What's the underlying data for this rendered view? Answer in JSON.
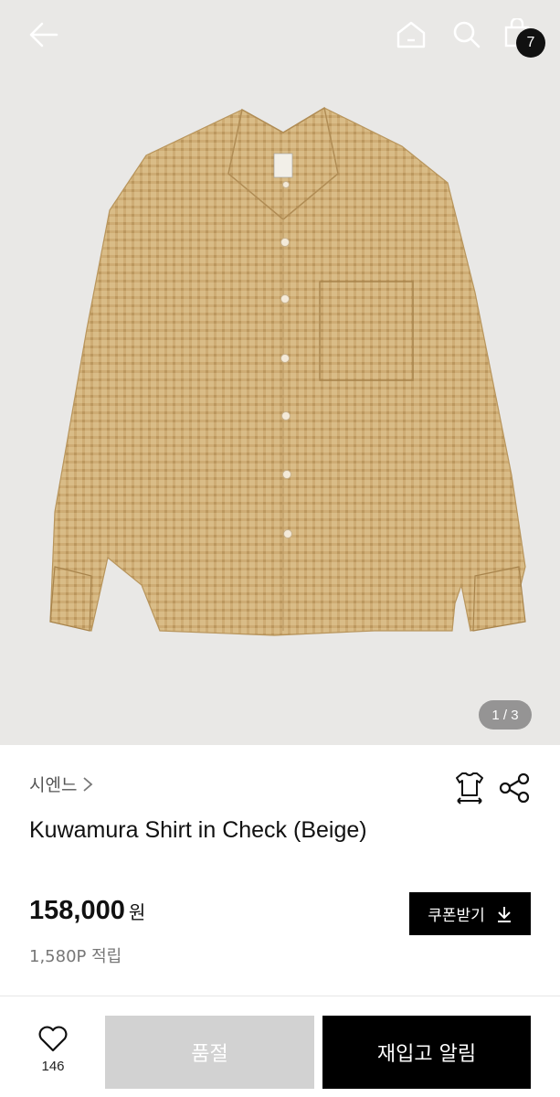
{
  "header": {
    "back_icon": "arrow-left-icon",
    "home_icon": "home-icon",
    "search_icon": "search-icon",
    "cart_icon": "shopping-bag-icon",
    "cart_count": "7"
  },
  "gallery": {
    "image_desc_label": "sienne",
    "pager": "1 / 3"
  },
  "product": {
    "brand": "시엔느",
    "brand_chevron": ">",
    "title": "Kuwamura Shirt in Check (Beige)",
    "price": "158,000",
    "currency": "원",
    "points": "1,580P 적립",
    "size_icon": "size-guide-icon",
    "share_icon": "share-icon"
  },
  "coupon": {
    "label": "쿠폰받기",
    "icon": "download-icon"
  },
  "bottom_bar": {
    "wish_icon": "heart-icon",
    "wish_count": "146",
    "soldout_label": "품절",
    "restock_label": "재입고 알림"
  },
  "colors": {
    "background": "#e9e8e6",
    "shirt": "#d8b880",
    "primary_button": "#000000",
    "disabled_button": "#d2d2d2"
  }
}
